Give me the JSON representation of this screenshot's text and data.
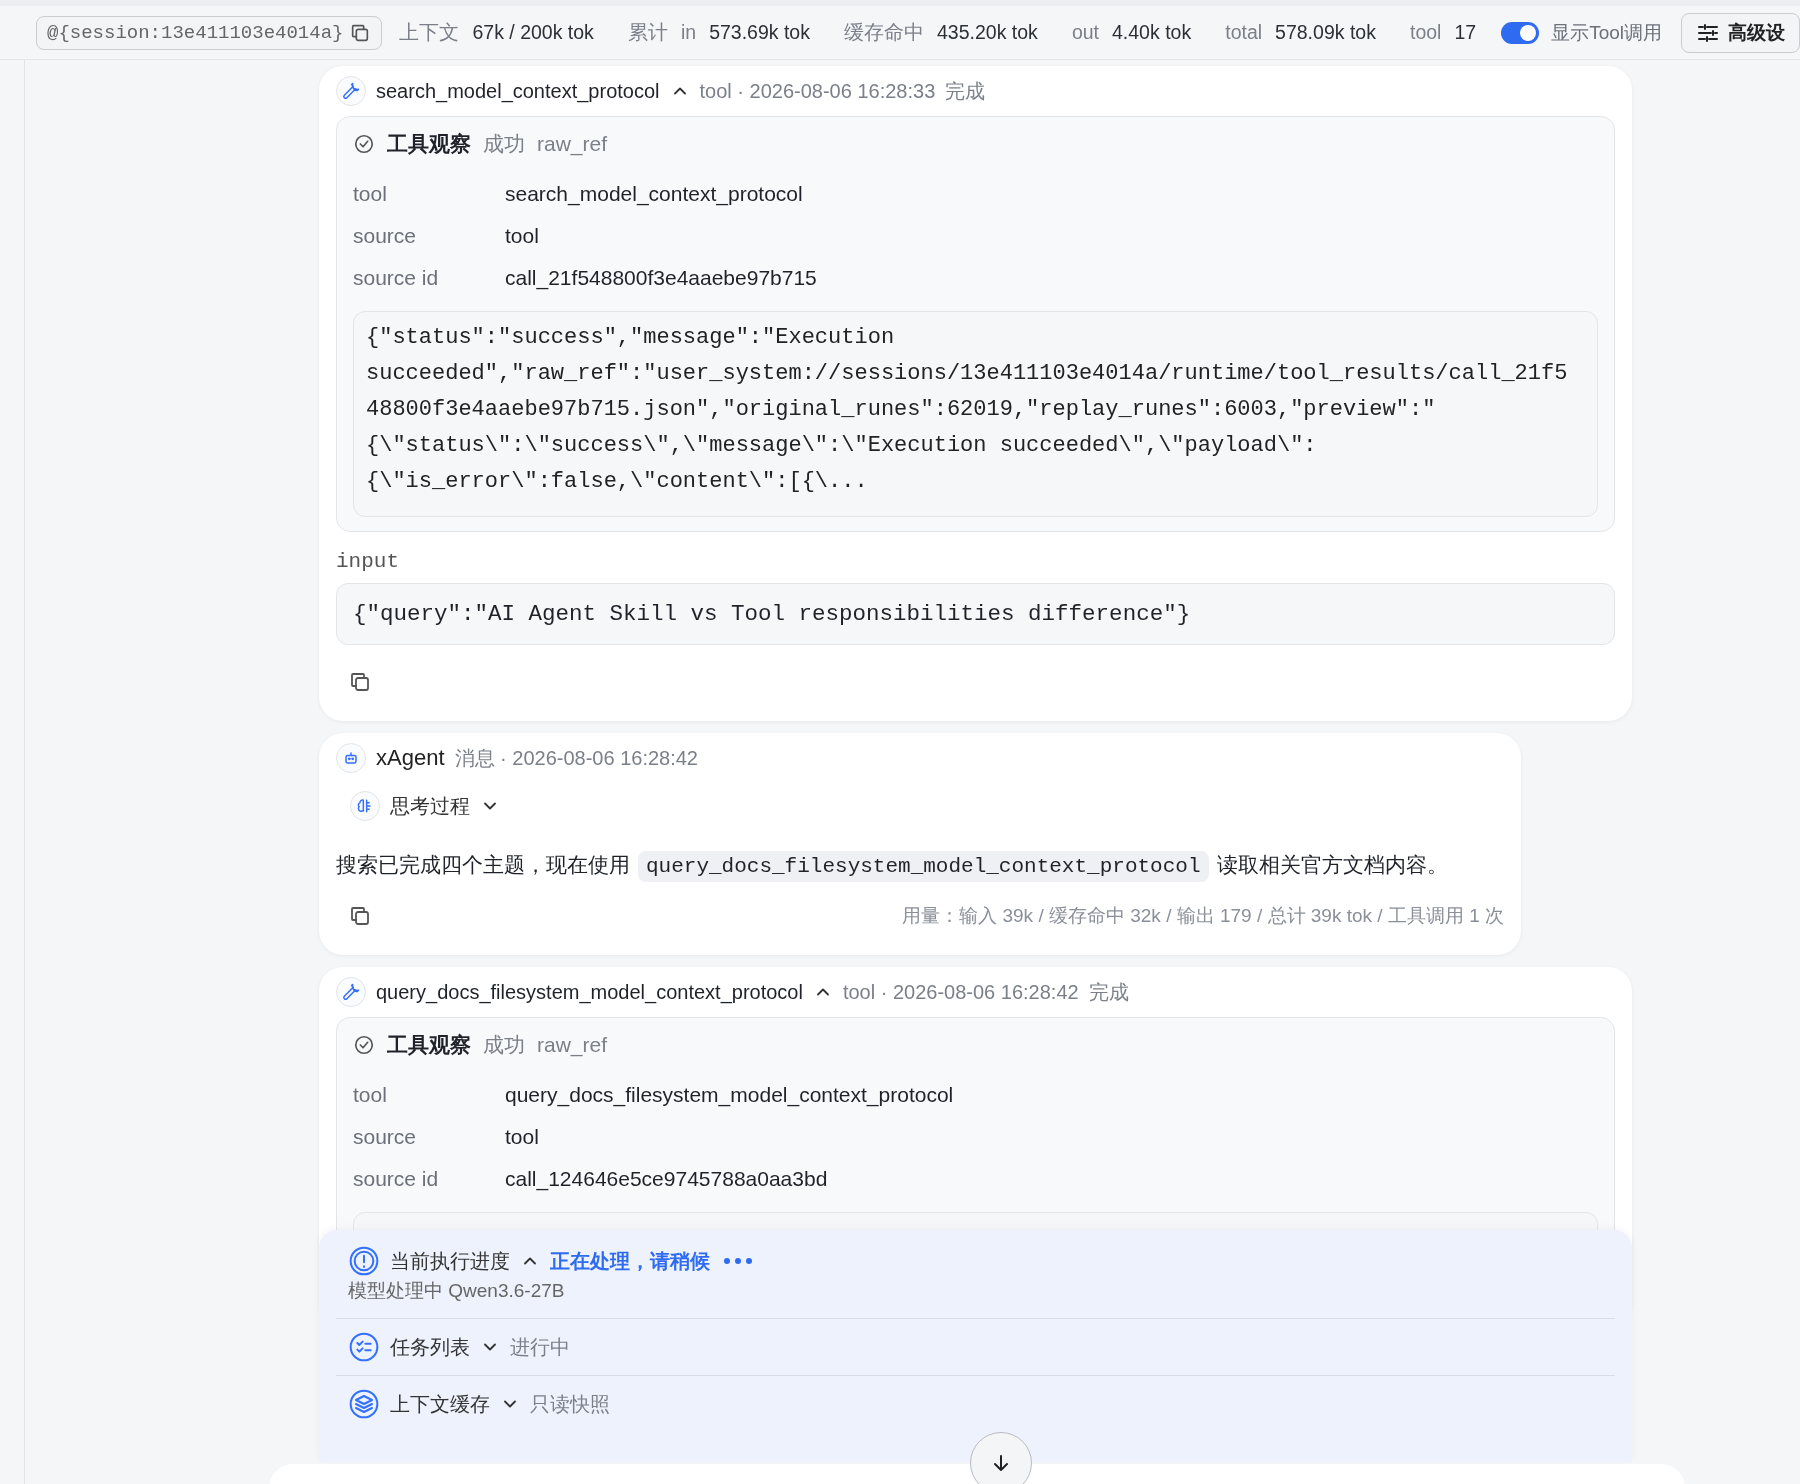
{
  "top_bar": {
    "session": "@{session:13e411103e4014a}",
    "stats": [
      {
        "label": "上下文",
        "value": "67k / 200k tok"
      },
      {
        "prefix": "累计",
        "label": "in",
        "value": "573.69k tok"
      },
      {
        "label": "缓存命中",
        "value": "435.20k tok"
      },
      {
        "label": "out",
        "value": "4.40k tok"
      },
      {
        "label": "total",
        "value": "578.09k tok"
      },
      {
        "label": "tool",
        "value": "17"
      }
    ],
    "toggle": {
      "label": "显示Tool调用",
      "on": true
    },
    "settings_button": "高级设"
  },
  "timeline": [
    {
      "kind": "tool_call",
      "name": "search_model_context_protocol",
      "expanded": true,
      "meta": "tool · 2026-08-06 16:28:33",
      "status": "完成",
      "observation": {
        "title": "工具观察",
        "status": "成功",
        "ref": "raw_ref",
        "fields": [
          {
            "label": "tool",
            "value": "search_model_context_protocol"
          },
          {
            "label": "source",
            "value": "tool"
          },
          {
            "label": "source id",
            "value": "call_21f548800f3e4aaebe97b715"
          }
        ],
        "output_lines": [
          "{\"status\":\"success\",\"message\":\"Execution",
          "succeeded\",\"raw_ref\":\"user_system://sessions/13e411103e4014a/runtime/tool_results/call_21f5",
          "48800f3e4aaebe97b715.json\",\"original_runes\":62019,\"replay_runes\":6003,\"preview\":\"",
          "{\\\"status\\\":\\\"success\\\",\\\"message\\\":\\\"Execution succeeded\\\",\\\"payload\\\":",
          "{\\\"is_error\\\":false,\\\"content\\\":[{\\..."
        ]
      },
      "input_label": "input",
      "input": "{\"query\":\"AI Agent Skill vs Tool responsibilities difference\"}"
    },
    {
      "kind": "message",
      "author": "xAgent",
      "meta": "消息 · 2026-08-06 16:28:42",
      "thinking": {
        "label": "思考过程",
        "expanded": false
      },
      "segments": [
        {
          "kind": "text",
          "text": "搜索已完成四个主题，现在使用"
        },
        {
          "kind": "code",
          "text": "query_docs_filesystem_model_context_protocol"
        },
        {
          "kind": "text",
          "text": "读取相关官方文档内容。"
        }
      ],
      "usage": "用量：输入 39k / 缓存命中 32k / 输出 179 / 总计 39k tok / 工具调用 1 次"
    },
    {
      "kind": "tool_call",
      "name": "query_docs_filesystem_model_context_protocol",
      "expanded": true,
      "meta": "tool · 2026-08-06 16:28:42",
      "status": "完成",
      "observation": {
        "title": "工具观察",
        "status": "成功",
        "ref": "raw_ref",
        "fields": [
          {
            "label": "tool",
            "value": "query_docs_filesystem_model_context_protocol"
          },
          {
            "label": "source",
            "value": "tool"
          },
          {
            "label": "source id",
            "value": "call_124646e5ce9745788a0aa3bd"
          }
        ]
      }
    }
  ],
  "status_panel": {
    "progress": {
      "title": "当前执行进度",
      "expanded": true,
      "status": "正在处理，请稍候",
      "detail": "模型处理中 Qwen3.6-27B"
    },
    "sections": [
      {
        "kind": "tasks",
        "title": "任务列表",
        "expanded": false,
        "status": "进行中"
      },
      {
        "kind": "cache",
        "title": "上下文缓存",
        "expanded": false,
        "status": "只读快照"
      }
    ]
  }
}
